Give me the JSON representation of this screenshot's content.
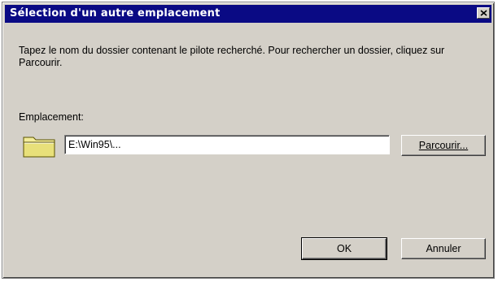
{
  "window": {
    "title": "Sélection d'un autre emplacement",
    "close_icon": "close-icon"
  },
  "instruction": "Tapez le nom du dossier contenant le pilote recherché. Pour rechercher un dossier, cliquez sur Parcourir.",
  "location": {
    "label": "Emplacement:",
    "value": "E:\\Win95\\...",
    "icon": "folder-icon"
  },
  "buttons": {
    "browse": "Parcourir...",
    "ok": "OK",
    "cancel": "Annuler"
  },
  "colors": {
    "titlebar": "#0a0a84",
    "dialog_bg": "#d4d0c8",
    "folder": "#e8e07a"
  }
}
